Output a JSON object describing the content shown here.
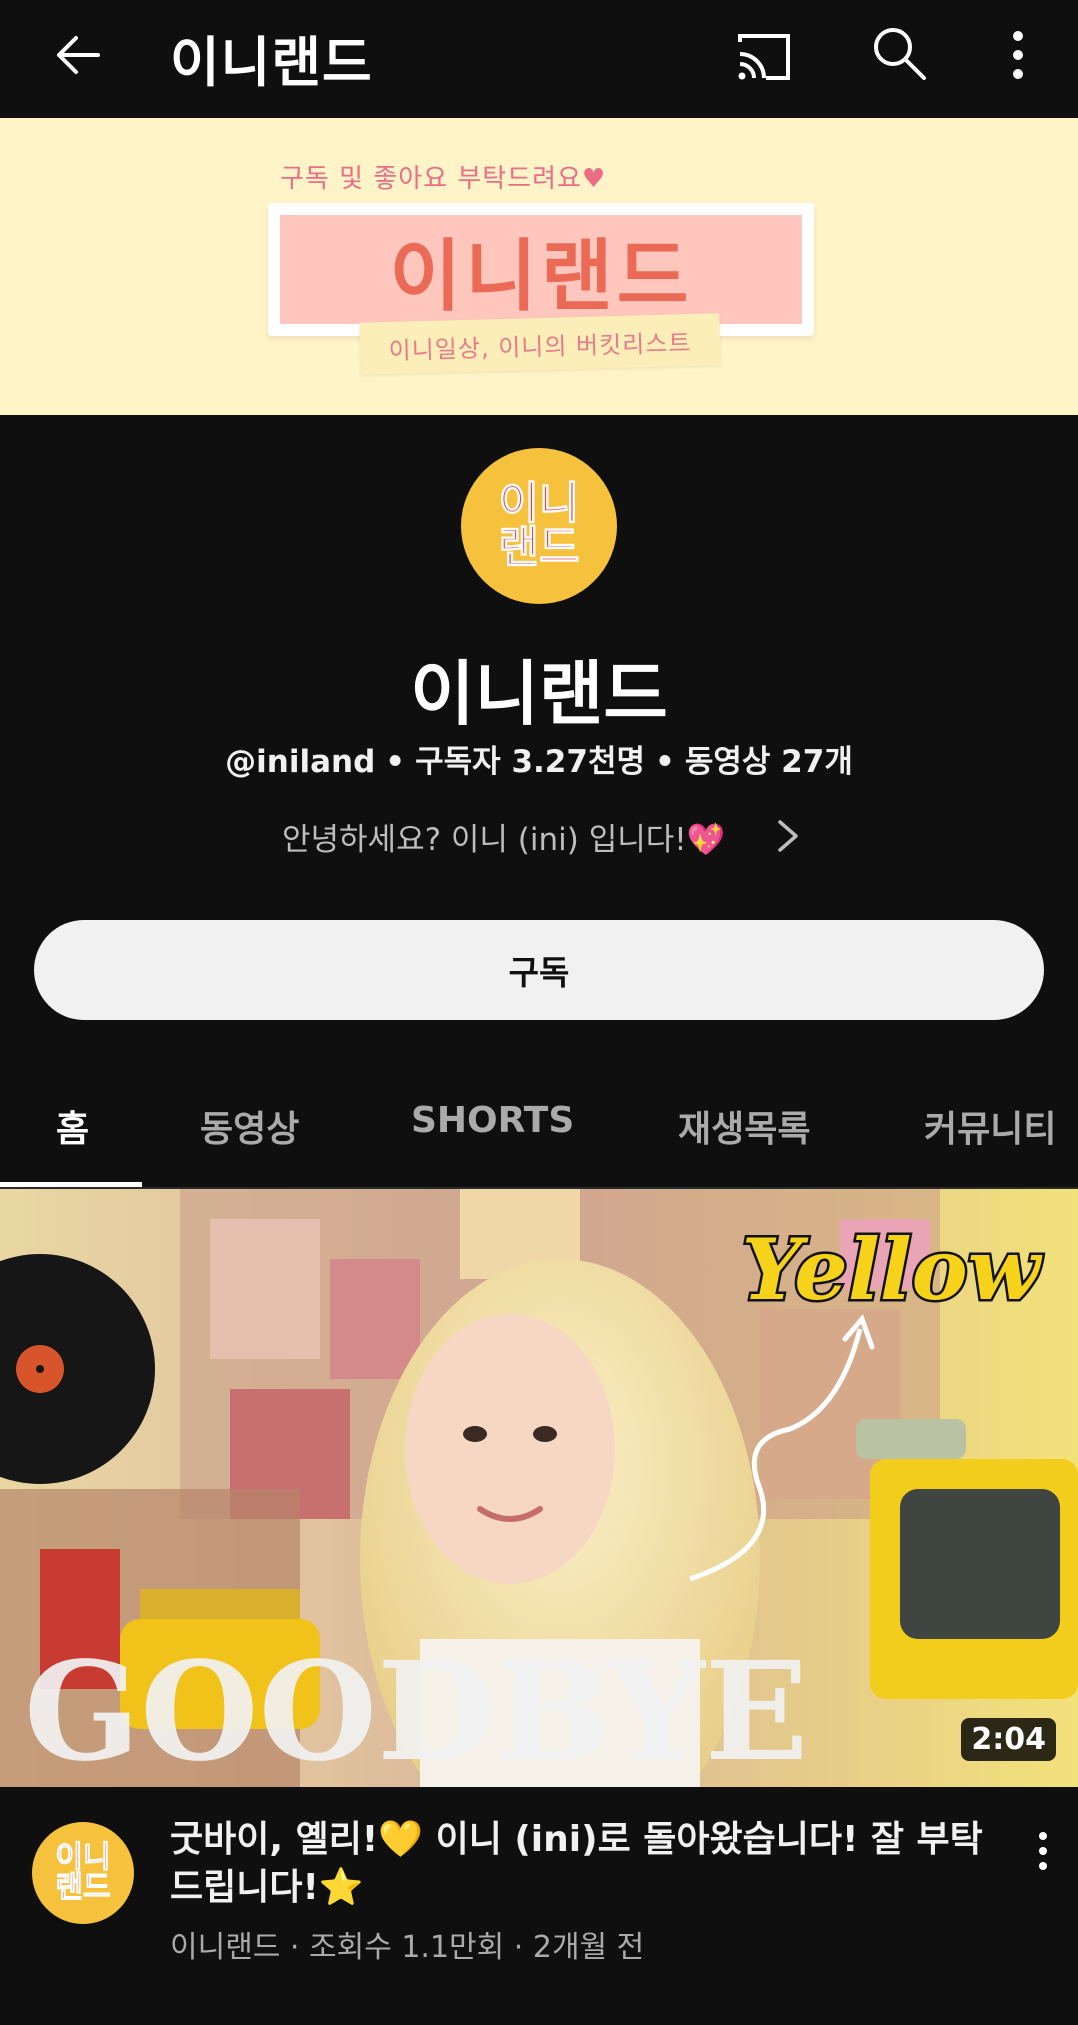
{
  "app_bar": {
    "title": "이니랜드",
    "icons": [
      "back-arrow-icon",
      "cast-icon",
      "search-icon",
      "more-vert-icon"
    ]
  },
  "banner": {
    "tagline": "구독 및 좋아요 부탁드려요♥",
    "title": "이니랜드",
    "subtitle": "이니일상, 이니의 버킷리스트",
    "colors": {
      "background": "#fff3c8",
      "board": "#ffc6bd",
      "text": "#ea6a55"
    }
  },
  "channel": {
    "avatar_line1": "이니",
    "avatar_line2": "랜드",
    "name": "이니랜드",
    "handle": "@iniland",
    "subscribers": "구독자 3.27천명",
    "videos": "동영상 27개",
    "separator": "•",
    "description": "안녕하세요? 이니 (ini) 입니다!💖",
    "subscribe_label": "구독"
  },
  "tabs": [
    {
      "label": "홈",
      "active": true
    },
    {
      "label": "동영상",
      "active": false
    },
    {
      "label": "SHORTS",
      "active": false
    },
    {
      "label": "재생목록",
      "active": false
    },
    {
      "label": "커뮤니티",
      "active": false
    }
  ],
  "featured_video": {
    "thumbnail_text_top": "Yellow",
    "thumbnail_text_bottom": "GOODBYE",
    "duration": "2:04",
    "title": "굿바이, 옐리!💛 이니 (ini)로 돌아왔습니다! 잘 부탁드립니다!⭐",
    "meta": "이니랜드 · 조회수 1.1만회 · 2개월 전",
    "avatar_line1": "이니",
    "avatar_line2": "랜드"
  }
}
